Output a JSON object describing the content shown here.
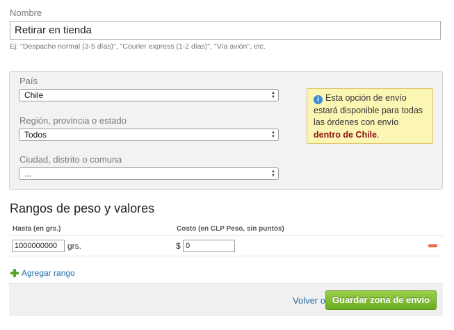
{
  "name_field": {
    "label": "Nombre",
    "value": "Retirar en tienda",
    "hint": "Ej: \"Despacho normal (3-5 días)\", \"Courier express (1-2 días)\", \"Vía avión\", etc."
  },
  "location": {
    "country": {
      "label": "País",
      "value": "Chile"
    },
    "region": {
      "label": "Región, provincia o estado",
      "value": "Todos"
    },
    "city": {
      "label": "Ciudad, distrito o comuna",
      "value": "..."
    },
    "info": {
      "icon": "info-icon",
      "text": "Esta opción de envío estará disponible para todas las órdenes con envío",
      "highlight": "dentro de Chile",
      "end": "."
    }
  },
  "ranges": {
    "title": "Rangos de peso y valores",
    "col_weight": "Hasta (en grs.)",
    "col_cost": "Costo (en CLP Peso, sin puntos)",
    "rows": [
      {
        "weight": "1000000000",
        "weight_unit": "grs.",
        "currency": "$",
        "cost": "0"
      }
    ],
    "add_label": "Agregar rango"
  },
  "footer": {
    "back_label": "Volver o",
    "save_label": "Guardar zona de envío"
  },
  "colors": {
    "accent_green": "#7dbd32",
    "info_bg": "#fcf6b5",
    "highlight_red": "#8b0f0f",
    "link_blue": "#1f6ea8"
  }
}
